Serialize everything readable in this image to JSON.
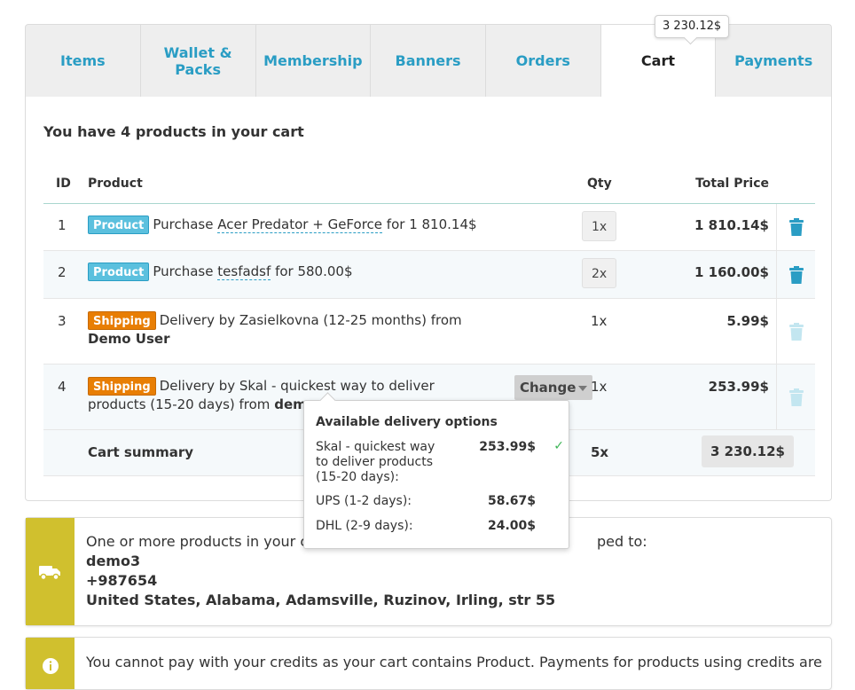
{
  "tabs": [
    {
      "label": "Items"
    },
    {
      "label": "Wallet & Packs"
    },
    {
      "label": "Membership"
    },
    {
      "label": "Banners"
    },
    {
      "label": "Orders"
    },
    {
      "label": "Cart"
    },
    {
      "label": "Payments"
    }
  ],
  "cart_badge": "3 230.12$",
  "cart_title": "You have 4 products in your cart",
  "table": {
    "headers": {
      "id": "ID",
      "product": "Product",
      "qty": "Qty",
      "total": "Total Price"
    },
    "rows": [
      {
        "id": "1",
        "label": "Product",
        "pre": "Purchase",
        "link": "Acer Predator + GeForce",
        "post": "for 1 810.14$",
        "qty": "1x",
        "total": "1 810.14$"
      },
      {
        "id": "2",
        "label": "Product",
        "pre": "Purchase",
        "link": "tesfadsf",
        "post": "for 580.00$",
        "qty": "2x",
        "total": "1 160.00$"
      },
      {
        "id": "3",
        "label": "Shipping",
        "text": "Delivery by Zasielkovna (12-25 months) from",
        "bold": "Demo User",
        "qty": "1x",
        "total": "5.99$"
      },
      {
        "id": "4",
        "label": "Shipping",
        "text": "Delivery by Skal - quickest way to deliver products (15-20 days) from",
        "bold": "demo",
        "change": "Change",
        "qty": "1x",
        "total": "253.99$"
      }
    ],
    "summary": {
      "label": "Cart summary",
      "qty": "5x",
      "total": "3 230.12$"
    }
  },
  "delivery_popover": {
    "title": "Available delivery options",
    "options": [
      {
        "name": "Skal - quickest way to deliver products (15-20 days):",
        "price": "253.99$",
        "selected": true
      },
      {
        "name": "UPS (1-2 days):",
        "price": "58.67$",
        "selected": false
      },
      {
        "name": "DHL (2-9 days):",
        "price": "24.00$",
        "selected": false
      }
    ]
  },
  "alerts": {
    "shipping": {
      "line1_a": "One or more products in your ca",
      "line1_b": "ped to:",
      "name": "demo3",
      "phone": "+987654",
      "address": "United States, Alabama, Adamsville, Ruzinov, Irling, str 55"
    },
    "credits": {
      "text": "You cannot pay with your credits as your cart contains Product. Payments for products using credits are"
    }
  },
  "colors": {
    "accent": "#2a9dc4",
    "product_label": "#5bc0de",
    "shipping_label": "#e87e04",
    "alert_side": "#d0c02e",
    "check": "#3db556"
  },
  "icons": {
    "delete": "trash-icon",
    "truck": "truck-icon",
    "info": "info-icon",
    "caret": "caret-down-icon",
    "selected": "check-icon"
  }
}
